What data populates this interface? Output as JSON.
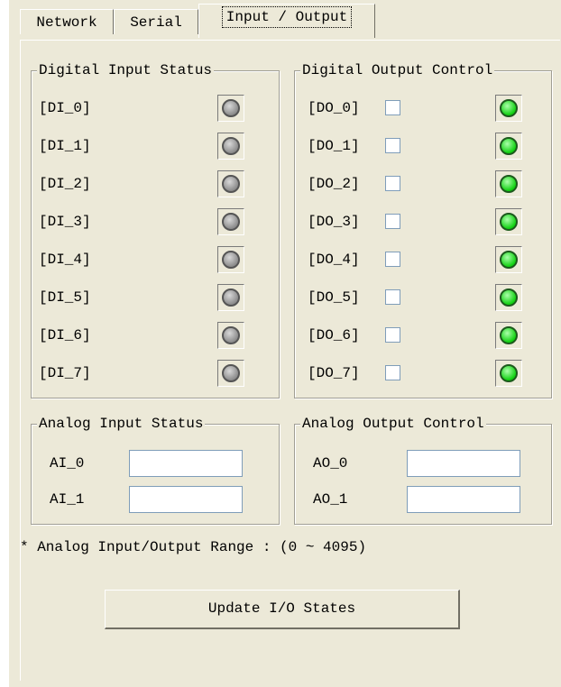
{
  "tabs": [
    {
      "label": "Network"
    },
    {
      "label": "Serial"
    },
    {
      "label": "Input / Output"
    }
  ],
  "digital_input": {
    "title": "Digital Input Status",
    "items": [
      {
        "label": "[DI_0]",
        "state": "off"
      },
      {
        "label": "[DI_1]",
        "state": "off"
      },
      {
        "label": "[DI_2]",
        "state": "off"
      },
      {
        "label": "[DI_3]",
        "state": "off"
      },
      {
        "label": "[DI_4]",
        "state": "off"
      },
      {
        "label": "[DI_5]",
        "state": "off"
      },
      {
        "label": "[DI_6]",
        "state": "off"
      },
      {
        "label": "[DI_7]",
        "state": "off"
      }
    ]
  },
  "digital_output": {
    "title": "Digital Output Control",
    "items": [
      {
        "label": "[DO_0]",
        "checked": false,
        "state": "on"
      },
      {
        "label": "[DO_1]",
        "checked": false,
        "state": "on"
      },
      {
        "label": "[DO_2]",
        "checked": false,
        "state": "on"
      },
      {
        "label": "[DO_3]",
        "checked": false,
        "state": "on"
      },
      {
        "label": "[DO_4]",
        "checked": false,
        "state": "on"
      },
      {
        "label": "[DO_5]",
        "checked": false,
        "state": "on"
      },
      {
        "label": "[DO_6]",
        "checked": false,
        "state": "on"
      },
      {
        "label": "[DO_7]",
        "checked": false,
        "state": "on"
      }
    ]
  },
  "analog_input": {
    "title": "Analog Input Status",
    "items": [
      {
        "label": "AI_0",
        "value": ""
      },
      {
        "label": "AI_1",
        "value": ""
      }
    ]
  },
  "analog_output": {
    "title": "Analog Output Control",
    "items": [
      {
        "label": "AO_0",
        "value": ""
      },
      {
        "label": "AO_1",
        "value": ""
      }
    ]
  },
  "range_note": "* Analog Input/Output Range : (0 ~ 4095)",
  "update_button": "Update I/O States",
  "colors": {
    "background": "#ece9d8",
    "led_on": "#10d010",
    "led_off": "#8c8c8c"
  }
}
